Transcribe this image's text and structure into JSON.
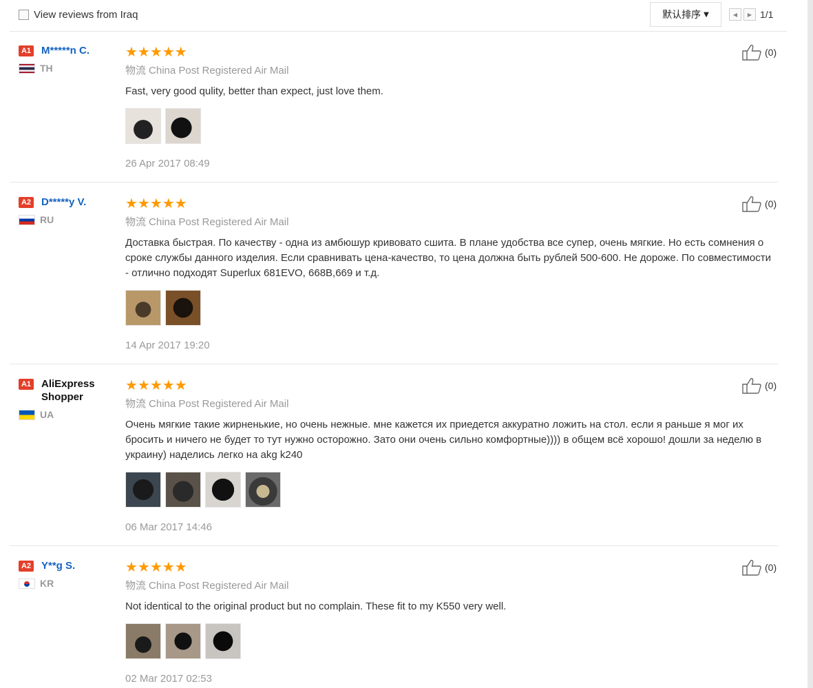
{
  "filter": {
    "label": "View reviews from Iraq"
  },
  "sort": {
    "label": "默认排序"
  },
  "pagination": {
    "text": "1/1"
  },
  "reviews": [
    {
      "level": "A1",
      "name": "M*****n C.",
      "country": "TH",
      "stars": "★★★★★",
      "shipping_prefix": "物流",
      "shipping": "China Post Registered Air Mail",
      "text": "Fast, very good qulity, better than expect, just love them.",
      "date": "26 Apr 2017 08:49",
      "likes": "(0)"
    },
    {
      "level": "A2",
      "name": "D*****y V.",
      "country": "RU",
      "stars": "★★★★★",
      "shipping_prefix": "物流",
      "shipping": "China Post Registered Air Mail",
      "text": "Доставка быстрая. По качеству - одна из амбюшур кривовато сшита. В плане удобства все супер, очень мягкие. Но есть сомнения о сроке службы данного изделия. Если сравнивать цена-качество, то цена должна быть рублей 500-600. Не дороже. По совместимости - отлично подходят Superlux 681EVO, 668B,669 и т.д.",
      "date": "14 Apr 2017 19:20",
      "likes": "(0)"
    },
    {
      "level": "A1",
      "name": "AliExpress Shopper",
      "country": "UA",
      "stars": "★★★★★",
      "shipping_prefix": "物流",
      "shipping": "China Post Registered Air Mail",
      "text": "Очень мягкие такие жирненькие, но очень нежные. мне кажется их приедется аккуратно ложить на стол. если я раньше я мог их бросить и ничего не будет то тут нужно осторожно. Зато они очень сильно комфортные)))) в общем всё хорошо! дошли за неделю в украину) наделись легко на akg k240",
      "date": "06 Mar 2017 14:46",
      "likes": "(0)"
    },
    {
      "level": "A2",
      "name": "Y**g S.",
      "country": "KR",
      "stars": "★★★★★",
      "shipping_prefix": "物流",
      "shipping": "China Post Registered Air Mail",
      "text": "Not identical to the original product but no complain. These fit to my K550 very well.",
      "date": "02 Mar 2017 02:53",
      "likes": "(0)"
    }
  ]
}
